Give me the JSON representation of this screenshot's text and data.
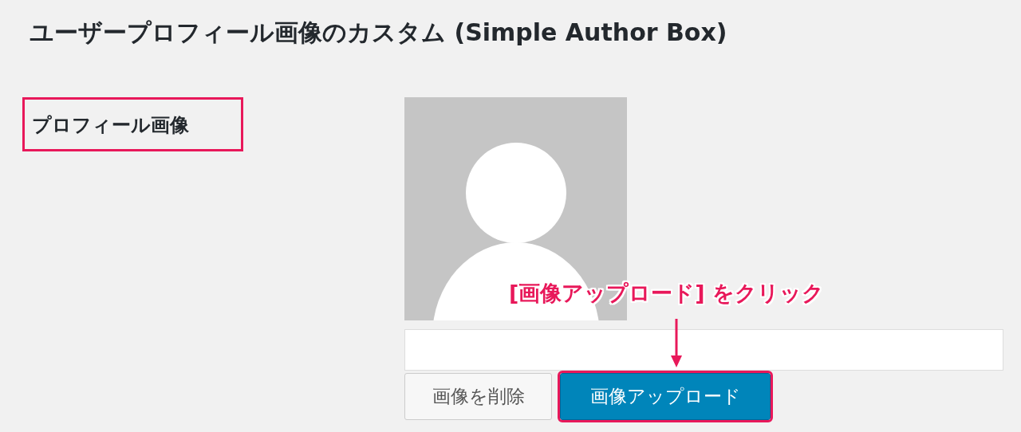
{
  "title": "ユーザープロフィール画像のカスタム (Simple Author Box)",
  "field": {
    "label": "プロフィール画像",
    "highlighted": true,
    "avatar": {
      "kind": "placeholder"
    }
  },
  "buttons": [
    {
      "label": "画像を削除",
      "kind": "secondary",
      "highlighted": false
    },
    {
      "label": "画像アップロード",
      "kind": "primary",
      "highlighted": true
    }
  ],
  "annotation": {
    "text": "[画像アップロード] をクリック",
    "color": "#e8185a"
  }
}
